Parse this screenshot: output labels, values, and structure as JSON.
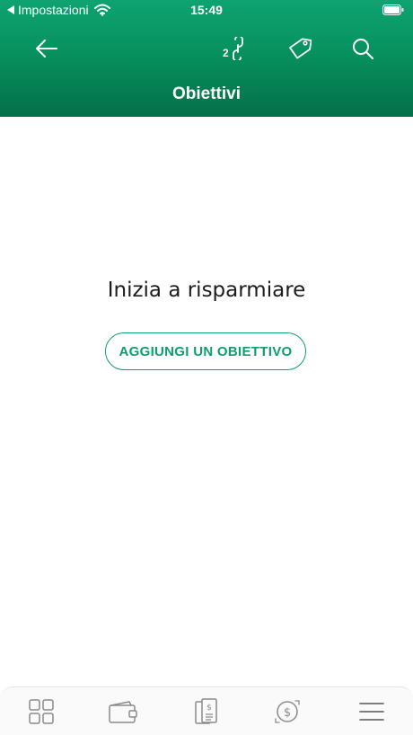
{
  "status_bar": {
    "back_label": "Impostazioni",
    "time": "15:49"
  },
  "header": {
    "title": "Obiettivi",
    "link_badge": "2"
  },
  "empty_state": {
    "title": "Inizia a risparmiare",
    "button_label": "AGGIUNGI UN OBIETTIVO"
  },
  "icons": {
    "back": "arrow-left-icon",
    "link": "link-icon",
    "tag": "tag-icon",
    "search": "search-icon",
    "dashboard": "grid-icon",
    "wallet": "wallet-icon",
    "document": "document-dollar-icon",
    "transfer": "dollar-exchange-icon",
    "menu": "hamburger-menu-icon"
  },
  "colors": {
    "brand_green": "#0E9E6B",
    "header_dark_green": "#066F49",
    "tab_icon_gray": "#8A8A8A"
  }
}
